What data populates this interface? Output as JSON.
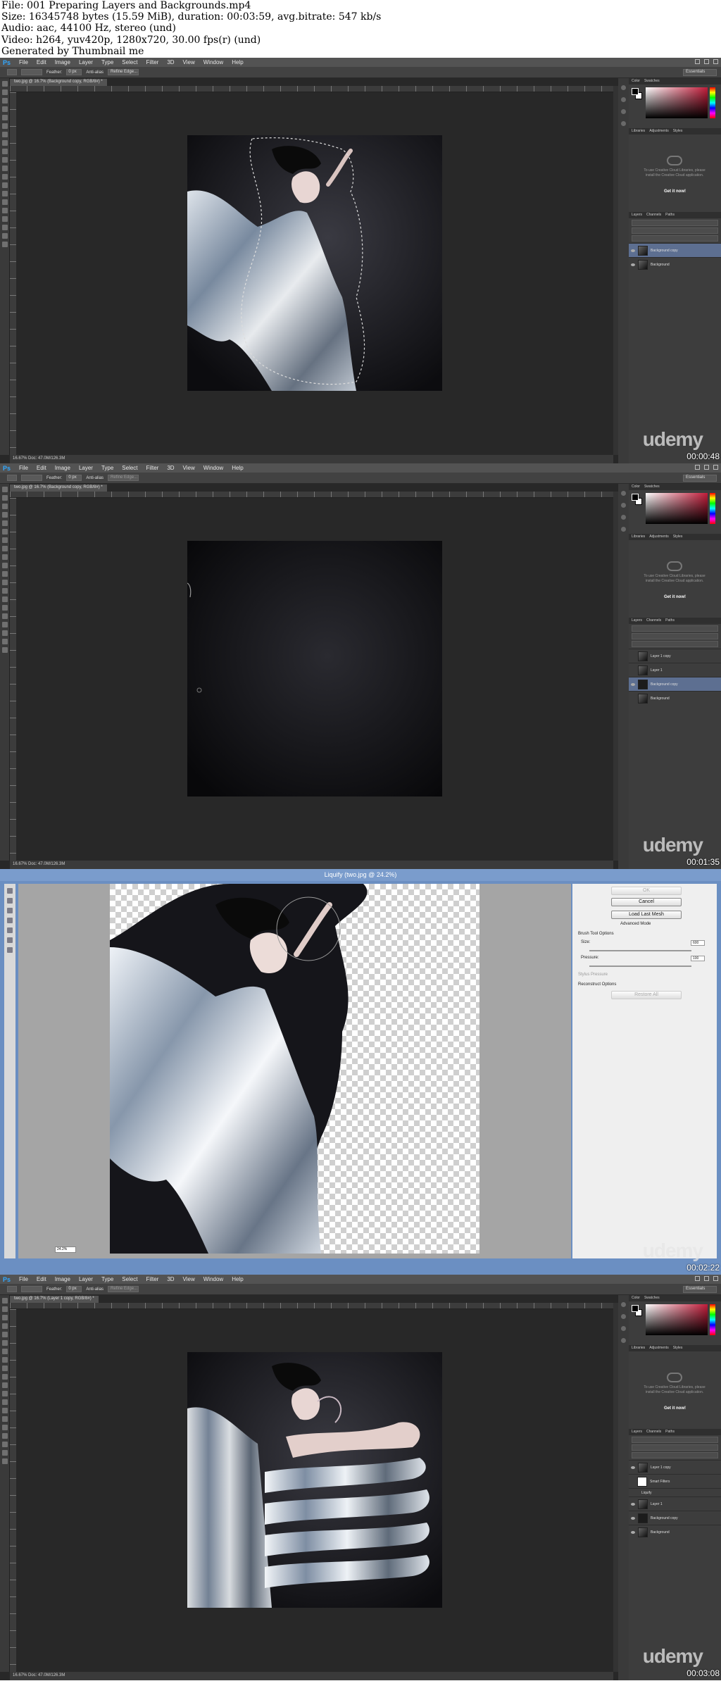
{
  "meta": {
    "lines": [
      "File: 001 Preparing Layers and Backgrounds.mp4",
      "Size: 16345748 bytes (15.59 MiB), duration: 00:03:59, avg.bitrate: 547 kb/s",
      "Audio: aac, 44100 Hz, stereo (und)",
      "Video: h264, yuv420p, 1280x720, 30.00 fps(r) (und)",
      "Generated by Thumbnail me"
    ]
  },
  "ps": {
    "logo": "Ps",
    "menu": [
      "File",
      "Edit",
      "Image",
      "Layer",
      "Type",
      "Select",
      "Filter",
      "3D",
      "View",
      "Window",
      "Help"
    ],
    "feather_label": "Feather:",
    "feather_value": "0 px",
    "anti_alias": "Anti-alias",
    "refine_edge": "Refine Edge...",
    "workspace": "Essentials",
    "color_tabs": [
      "Color",
      "Swatches"
    ],
    "lib_tabs": [
      "Libraries",
      "Adjustments",
      "Styles"
    ],
    "lib_message": "To use Creative Cloud Libraries, please install the Creative Cloud application.",
    "get_it_now": "Get it now!",
    "layer_tabs": [
      "Layers",
      "Channels",
      "Paths"
    ],
    "watermark": "udemy"
  },
  "frames": [
    {
      "doc_tab": "two.jpg @ 16.7% (Background copy, RGB/8#) *",
      "status": "16.67%    Doc: 47.0M/126.3M",
      "timestamp": "00:00:48",
      "layers": [
        "Background copy",
        "Background"
      ]
    },
    {
      "doc_tab": "two.jpg @ 16.7% (Background copy, RGB/8#) *",
      "status": "16.67%    Doc: 47.0M/126.3M",
      "timestamp": "00:01:35",
      "layers": [
        "Layer 1 copy",
        "Layer 1",
        "Background copy",
        "Background"
      ]
    },
    {
      "doc_tab": "two.jpg @ 16.7% (Layer 1 copy, RGB/8#) *",
      "status": "16.67%    Doc: 47.0M/126.3M",
      "timestamp": "00:03:08",
      "layers": [
        "Layer 1 copy",
        "Smart Filters",
        "Liquify",
        "Layer 1",
        "Background copy",
        "Background"
      ]
    }
  ],
  "liquify": {
    "title": "Liquify (two.jpg @ 24.2%)",
    "ok": "OK",
    "cancel": "Cancel",
    "load_last_mesh": "Load Last Mesh",
    "advanced_mode": "Advanced Mode",
    "brush_tool_options": "Brush Tool Options",
    "size_label": "Size:",
    "size_value": "600",
    "pressure_label": "Pressure:",
    "pressure_value": "100",
    "stylus_pressure": "Stylus Pressure",
    "reconstruct_options": "Reconstruct Options",
    "restore_all": "Restore All",
    "zoom": "24.2%",
    "timestamp": "00:02:22"
  }
}
